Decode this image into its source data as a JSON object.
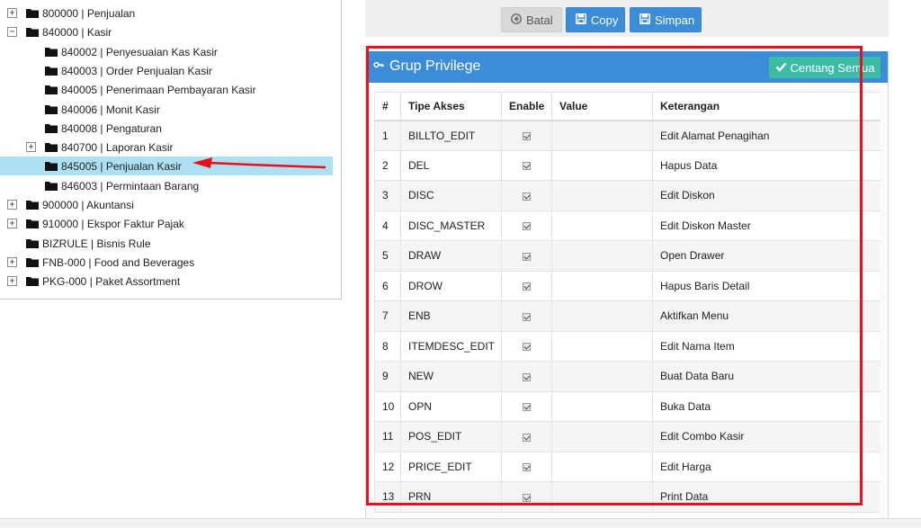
{
  "tree": {
    "items": [
      {
        "label": "800000 | Penjualan",
        "toggle": "+"
      },
      {
        "label": "840000 | Kasir",
        "toggle": "−"
      },
      {
        "label": "840002 | Penyesuaian Kas Kasir",
        "toggle": ""
      },
      {
        "label": "840003 | Order Penjualan Kasir",
        "toggle": ""
      },
      {
        "label": "840005 | Penerimaan Pembayaran Kasir",
        "toggle": ""
      },
      {
        "label": "840006 | Monit Kasir",
        "toggle": ""
      },
      {
        "label": "840008 | Pengaturan",
        "toggle": ""
      },
      {
        "label": "840700 | Laporan Kasir",
        "toggle": "+"
      },
      {
        "label": "845005 | Penjualan Kasir",
        "toggle": "",
        "selected": true
      },
      {
        "label": "846003 | Permintaan Barang",
        "toggle": ""
      },
      {
        "label": "900000 | Akuntansi",
        "toggle": "+"
      },
      {
        "label": "910000 | Ekspor Faktur Pajak",
        "toggle": "+"
      },
      {
        "label": "BIZRULE | Bisnis Rule",
        "toggle": ""
      },
      {
        "label": "FNB-000 | Food and Beverages",
        "toggle": "+"
      },
      {
        "label": "PKG-000 | Paket Assortment",
        "toggle": "+"
      }
    ]
  },
  "toolbar": {
    "cancel_label": "Batal",
    "copy_label": "Copy",
    "save_label": "Simpan"
  },
  "panel": {
    "title": "Grup Privilege",
    "check_all_label": "Centang Semua"
  },
  "table": {
    "headers": [
      "#",
      "Tipe Akses",
      "Enable",
      "Value",
      "Keterangan"
    ],
    "rows": [
      {
        "no": "1",
        "type": "BILLTO_EDIT",
        "enabled": true,
        "value": "",
        "desc": "Edit Alamat Penagihan"
      },
      {
        "no": "2",
        "type": "DEL",
        "enabled": true,
        "value": "",
        "desc": "Hapus Data"
      },
      {
        "no": "3",
        "type": "DISC",
        "enabled": true,
        "value": "",
        "desc": "Edit Diskon"
      },
      {
        "no": "4",
        "type": "DISC_MASTER",
        "enabled": true,
        "value": "",
        "desc": "Edit Diskon Master"
      },
      {
        "no": "5",
        "type": "DRAW",
        "enabled": true,
        "value": "",
        "desc": "Open Drawer"
      },
      {
        "no": "6",
        "type": "DROW",
        "enabled": true,
        "value": "",
        "desc": "Hapus Baris Detail"
      },
      {
        "no": "7",
        "type": "ENB",
        "enabled": true,
        "value": "",
        "desc": "Aktifkan Menu"
      },
      {
        "no": "8",
        "type": "ITEMDESC_EDIT",
        "enabled": true,
        "value": "",
        "desc": "Edit Nama Item"
      },
      {
        "no": "9",
        "type": "NEW",
        "enabled": true,
        "value": "",
        "desc": "Buat Data Baru"
      },
      {
        "no": "10",
        "type": "OPN",
        "enabled": true,
        "value": "",
        "desc": "Buka Data"
      },
      {
        "no": "11",
        "type": "POS_EDIT",
        "enabled": true,
        "value": "",
        "desc": "Edit Combo Kasir"
      },
      {
        "no": "12",
        "type": "PRICE_EDIT",
        "enabled": true,
        "value": "",
        "desc": "Edit Harga"
      },
      {
        "no": "13",
        "type": "PRN",
        "enabled": true,
        "value": "",
        "desc": "Print Data"
      }
    ]
  },
  "colors": {
    "primary": "#3c8dd8",
    "success": "#3cbca4",
    "selection": "#aee0f4",
    "annotation": "#e8101a"
  },
  "icons": {
    "cancel": "circle-arrow-left-icon",
    "copy": "floppy-icon",
    "save": "floppy-icon",
    "title": "key-icon",
    "check_all": "check-icon",
    "tree": "folder-icon"
  }
}
